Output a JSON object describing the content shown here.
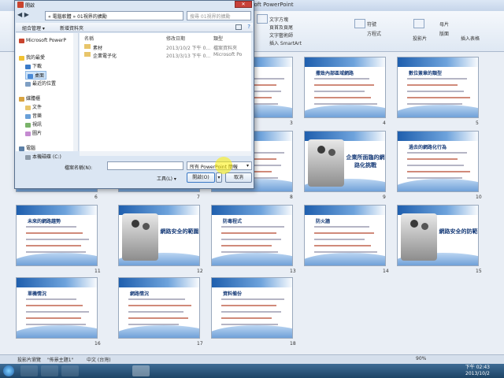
{
  "app": {
    "title": "Microsoft PowerPoint"
  },
  "ribbon": {
    "items": [
      "文字方塊",
      "頁首及頁尾",
      "文字藝術師",
      "插入 SmartArt",
      "符號",
      "方程式",
      "投影片",
      "母片",
      "版面",
      "插入表格"
    ]
  },
  "slides": [
    {
      "num": "3",
      "kind": "list",
      "title": ""
    },
    {
      "num": "4",
      "kind": "list",
      "title": "撒致內部區域網路"
    },
    {
      "num": "5",
      "kind": "list",
      "title": "數位簽章的類型"
    },
    {
      "num": "6",
      "kind": "list",
      "title": ""
    },
    {
      "num": "7",
      "kind": "list",
      "title": ""
    },
    {
      "num": "8",
      "kind": "list",
      "title": "民網路"
    },
    {
      "num": "9",
      "kind": "cover",
      "title": "企業所面臨的網路化挑戰"
    },
    {
      "num": "10",
      "kind": "list",
      "title": "過去的網路化行為"
    },
    {
      "num": "11",
      "kind": "list",
      "title": "未來的網路趨勢"
    },
    {
      "num": "12",
      "kind": "cover",
      "title": "網路安全的範圍"
    },
    {
      "num": "13",
      "kind": "list",
      "title": "防毒程式"
    },
    {
      "num": "14",
      "kind": "list",
      "title": "防火牆"
    },
    {
      "num": "15",
      "kind": "cover",
      "title": "網路安全的防範"
    },
    {
      "num": "16",
      "kind": "list",
      "title": "單機情況"
    },
    {
      "num": "17",
      "kind": "list",
      "title": "網路情況"
    },
    {
      "num": "18",
      "kind": "list",
      "title": "資料備份"
    }
  ],
  "status": {
    "view": "投影片瀏覽",
    "theme": "\"佈景主題1\"",
    "language": "中文 (台灣)",
    "zoom": "90%"
  },
  "taskbar": {
    "time": "下午 02:43",
    "date": "2013/10/2"
  },
  "dialog": {
    "title": "開啟",
    "address": "« 電腦軟體 » 01視界的擴勵",
    "search_placeholder": "搜尋 01視界的擴勵",
    "toolbar": {
      "organize": "組合管理 ▾",
      "new_folder": "新增資料夾"
    },
    "tree": [
      {
        "label": "Microsoft PowerP",
        "icon": "powerpoint-icon",
        "selected": false
      },
      {
        "label": "我的最愛",
        "icon": "favorites-star-icon",
        "selected": false
      },
      {
        "label": "下載",
        "icon": "download-folder-icon",
        "selected": false
      },
      {
        "label": "桌面",
        "icon": "desktop-icon",
        "selected": true
      },
      {
        "label": "最近的位置",
        "icon": "recent-places-icon",
        "selected": false
      },
      {
        "label": "媒體櫃",
        "icon": "libraries-icon",
        "selected": false
      },
      {
        "label": "文件",
        "icon": "documents-icon",
        "selected": false
      },
      {
        "label": "音樂",
        "icon": "music-icon",
        "selected": false
      },
      {
        "label": "視訊",
        "icon": "video-icon",
        "selected": false
      },
      {
        "label": "圖片",
        "icon": "pictures-icon",
        "selected": false
      },
      {
        "label": "電腦",
        "icon": "computer-icon",
        "selected": false
      },
      {
        "label": "本機磁碟 (C:)",
        "icon": "drive-icon",
        "selected": false
      }
    ],
    "columns": [
      "名稱",
      "修改日期",
      "類型"
    ],
    "files": [
      {
        "name": "素材",
        "date": "2013/10/2 下午 0...",
        "type": "檔案資料夾"
      },
      {
        "name": "企業電子化",
        "date": "2013/3/13 下午 0...",
        "type": "Microsoft Po"
      }
    ],
    "filename_label": "檔案名稱(N):",
    "filename_value": "",
    "filetype": "所有 PowerPoint 簡報",
    "tools": "工具(L) ▾",
    "open": "開啟(O)",
    "cancel": "取消"
  }
}
